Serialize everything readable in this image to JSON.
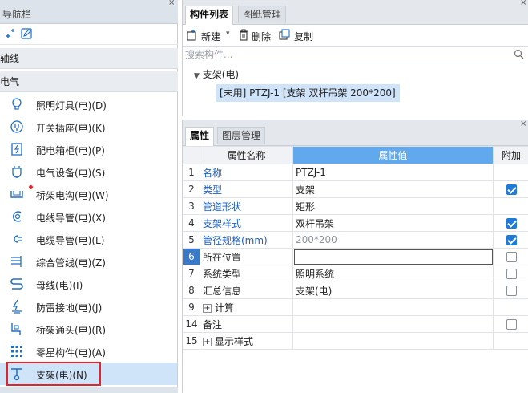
{
  "nav": {
    "title": "导航栏",
    "close_glyph": "×",
    "categories": [
      {
        "label": "轴线"
      },
      {
        "label": "电气"
      }
    ],
    "items": [
      {
        "label": "照明灯具(电)(D)",
        "icon": "bulb-icon"
      },
      {
        "label": "开关插座(电)(K)",
        "icon": "switch-socket-icon"
      },
      {
        "label": "配电箱柜(电)(P)",
        "icon": "distribution-box-icon"
      },
      {
        "label": "电气设备(电)(S)",
        "icon": "electrical-device-icon"
      },
      {
        "label": "桥架电沟(电)(W)",
        "icon": "cable-tray-icon",
        "has_alert_dot": true
      },
      {
        "label": "电线导管(电)(X)",
        "icon": "wire-conduit-icon"
      },
      {
        "label": "电缆导管(电)(L)",
        "icon": "cable-conduit-icon"
      },
      {
        "label": "综合管线(电)(Z)",
        "icon": "combined-pipeline-icon"
      },
      {
        "label": "母线(电)(I)",
        "icon": "busbar-icon"
      },
      {
        "label": "防雷接地(电)(J)",
        "icon": "lightning-ground-icon"
      },
      {
        "label": "桥架通头(电)(R)",
        "icon": "tray-joint-icon"
      },
      {
        "label": "零星构件(电)(A)",
        "icon": "misc-component-icon"
      },
      {
        "label": "支架(电)(N)",
        "icon": "support-icon",
        "selected": true
      }
    ]
  },
  "components": {
    "tabs": [
      {
        "label": "构件列表",
        "active": true
      },
      {
        "label": "图纸管理",
        "active": false
      }
    ],
    "toolbar": {
      "new_label": "新建",
      "delete_label": "删除",
      "copy_label": "复制"
    },
    "search": {
      "placeholder": "搜索构件..."
    },
    "tree": {
      "root_label": "支架(电)",
      "child_label": "[未用] PTZJ-1 [支架 双杆吊架 200*200]"
    }
  },
  "properties": {
    "tabs": [
      {
        "label": "属性",
        "active": true
      },
      {
        "label": "图层管理",
        "active": false
      }
    ],
    "headers": {
      "num": "",
      "name": "属性名称",
      "value": "属性值",
      "add": "附加"
    },
    "rows": [
      {
        "num": "1",
        "name": "名称",
        "value": "PTZJ-1",
        "blue": true,
        "checkbox": "none"
      },
      {
        "num": "2",
        "name": "类型",
        "value": "支架",
        "blue": true,
        "checkbox": "checked"
      },
      {
        "num": "3",
        "name": "管道形状",
        "value": "矩形",
        "blue": true,
        "checkbox": "none"
      },
      {
        "num": "4",
        "name": "支架样式",
        "value": "双杆吊架",
        "blue": true,
        "checkbox": "checked"
      },
      {
        "num": "5",
        "name": "管径规格(mm)",
        "value": "200*200",
        "blue": true,
        "value_gray": true,
        "checkbox": "checked"
      },
      {
        "num": "6",
        "name": "所在位置",
        "value": "",
        "selected": true,
        "checkbox": "unchecked"
      },
      {
        "num": "7",
        "name": "系统类型",
        "value": "照明系统",
        "checkbox": "unchecked"
      },
      {
        "num": "8",
        "name": "汇总信息",
        "value": "支架(电)",
        "checkbox": "unchecked"
      },
      {
        "num": "9",
        "name": "计算",
        "value": "",
        "expandable": true,
        "checkbox": "none"
      },
      {
        "num": "14",
        "name": "备注",
        "value": "",
        "checkbox": "unchecked"
      },
      {
        "num": "15",
        "name": "显示样式",
        "value": "",
        "expandable": true,
        "checkbox": "none"
      }
    ]
  },
  "colors": {
    "accent": "#62a8ec",
    "selection": "#cfe3f9",
    "highlight_border": "#e0262b",
    "link_text": "#1a5fc4",
    "checkbox_on": "#1f7bd8"
  }
}
